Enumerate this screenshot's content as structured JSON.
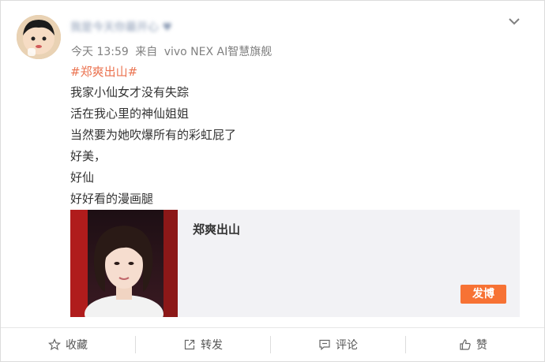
{
  "post": {
    "username": "我是今天你最开心 ♥",
    "time": "今天 13:59",
    "from": "来自",
    "device": "vivo NEX AI智慧旗舰",
    "hashtag": "#郑爽出山#",
    "lines": [
      "我家小仙女才没有失踪",
      "活在我心里的神仙姐姐",
      "当然要为她吹爆所有的彩虹屁了",
      "好美，",
      "好仙",
      "好好看的漫画腿"
    ]
  },
  "topic_card": {
    "title": "郑爽出山",
    "post_button": "发博"
  },
  "actions": {
    "favorite": "收藏",
    "repost": "转发",
    "comment": "评论",
    "like": "赞"
  },
  "colors": {
    "hashtag": "#eb7350",
    "post_button": "#f77234",
    "text": "#333333",
    "meta": "#808080"
  },
  "icons": {
    "menu": "chevron-down-icon",
    "favorite": "star-icon",
    "repost": "share-icon",
    "comment": "comment-icon",
    "like": "thumb-up-icon"
  }
}
